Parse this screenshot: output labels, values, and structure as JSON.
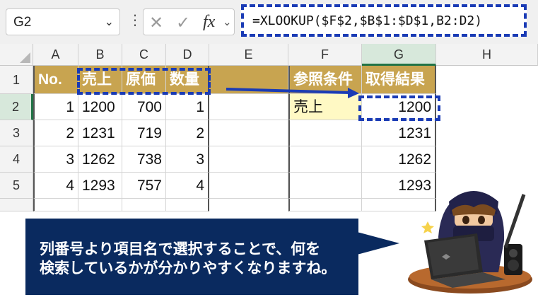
{
  "formula_bar": {
    "name_box": "G2",
    "name_box_chevron": "⌄",
    "more_icon": "⋮",
    "cancel_icon": "✕",
    "enter_icon": "✓",
    "fx_label": "fx",
    "fx_chevron": "⌄",
    "formula": "=XLOOKUP($F$2,$B$1:$D$1,B2:D2)"
  },
  "columns": [
    "A",
    "B",
    "C",
    "D",
    "E",
    "F",
    "G",
    "H"
  ],
  "rows": [
    "1",
    "2",
    "3",
    "4",
    "5"
  ],
  "cells": {
    "A1": "No.",
    "B1": "売上",
    "C1": "原価",
    "D1": "数量",
    "F1": "参照条件",
    "G1": "取得結果",
    "A2": "1",
    "B2": "1200",
    "C2": "700",
    "D2": "1",
    "F2": "売上",
    "G2": "1200",
    "A3": "2",
    "B3": "1231",
    "C3": "719",
    "D3": "2",
    "G3": "1231",
    "A4": "3",
    "B4": "1262",
    "C4": "738",
    "D4": "3",
    "G4": "1262",
    "A5": "4",
    "B5": "1293",
    "C5": "757",
    "D5": "4",
    "G5": "1293"
  },
  "callout": {
    "line1": "列番号より項目名で選択することで、何を",
    "line2": "検索しているかが分かりやすくなりますね。"
  },
  "colors": {
    "header_fill": "#c8a450",
    "lookup_fill": "#fff9c4",
    "highlight_dash": "#1a3bb5",
    "callout_bg": "#0a2a5f",
    "selected_header": "#d7e8db"
  },
  "icons": {
    "illustration": "ninja-with-laptop"
  }
}
